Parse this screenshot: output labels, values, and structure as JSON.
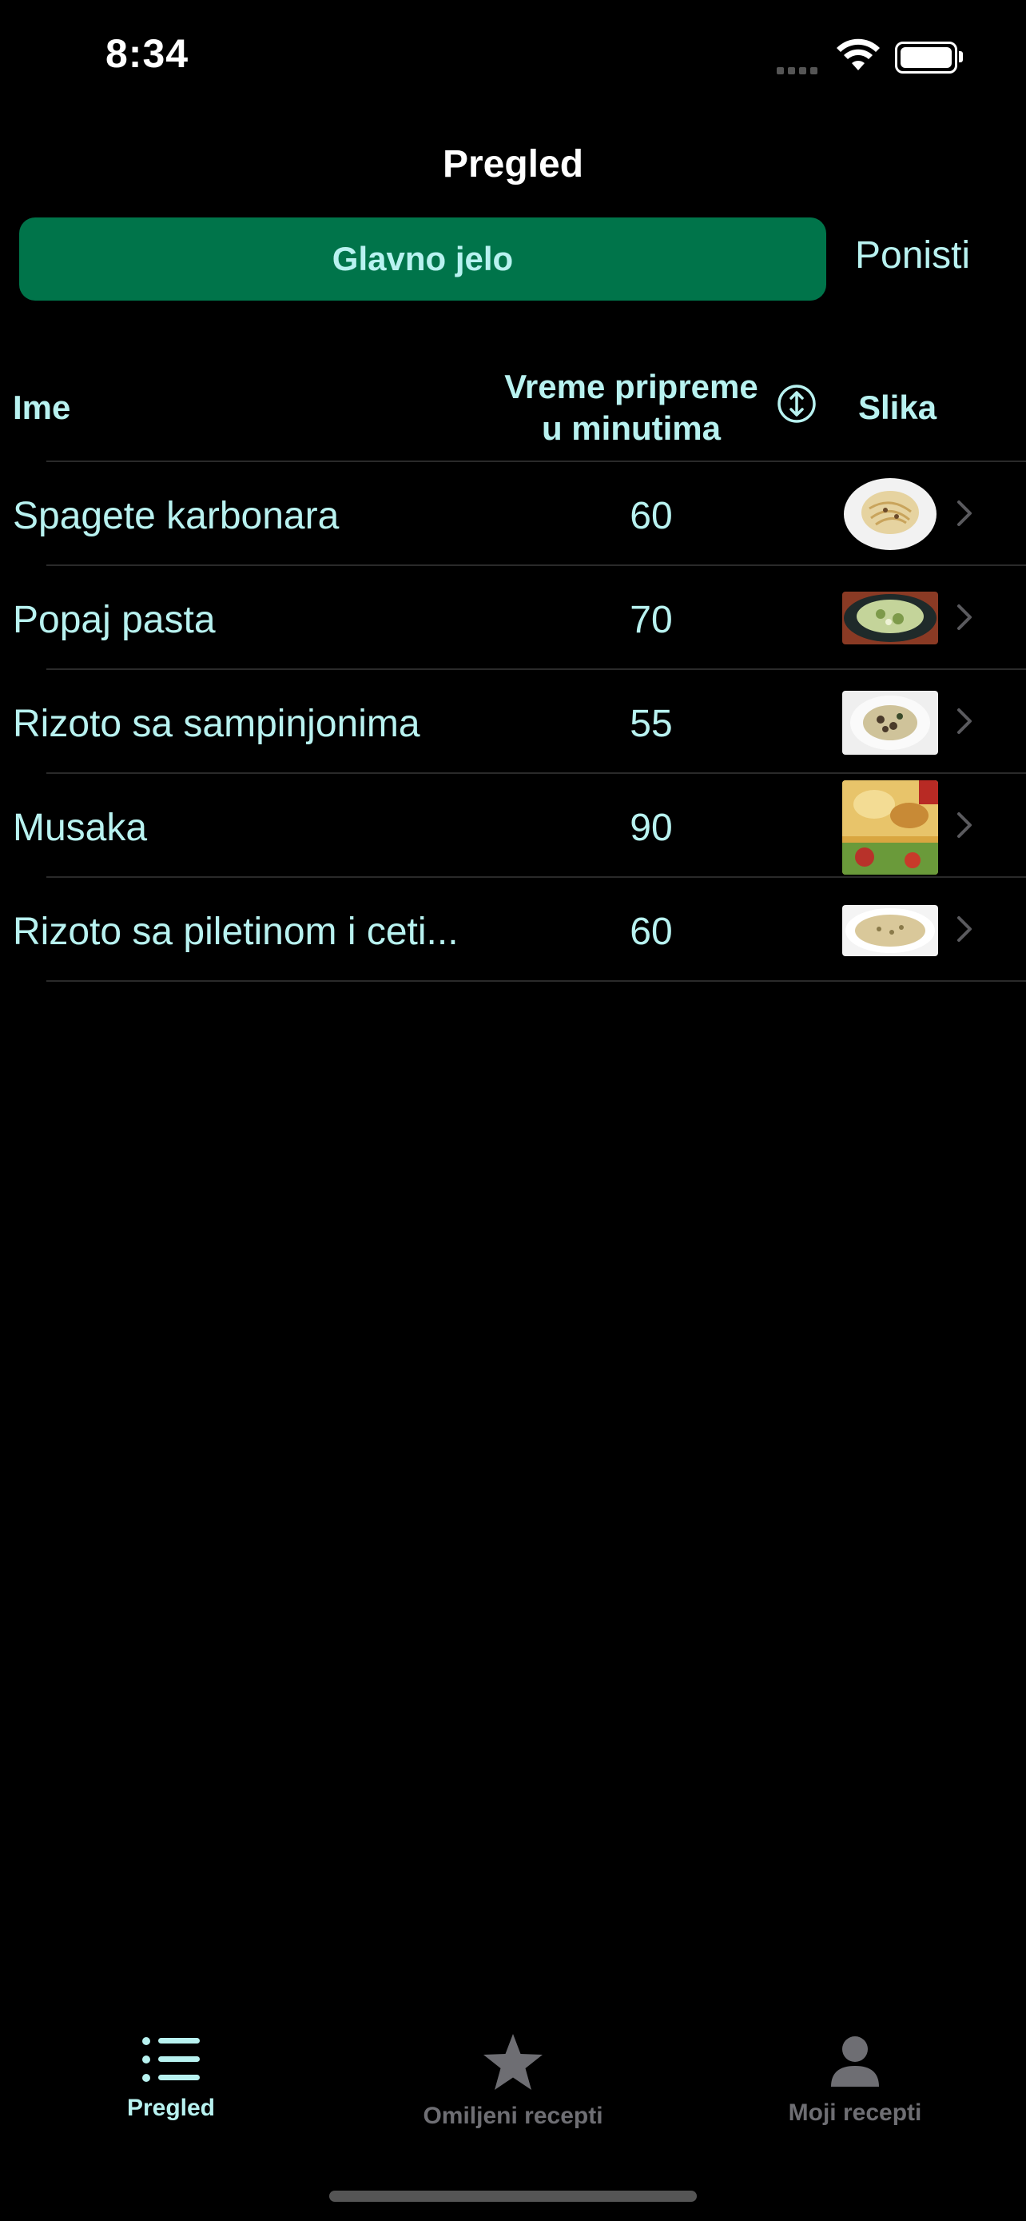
{
  "status": {
    "time": "8:34"
  },
  "nav": {
    "title": "Pregled"
  },
  "filter": {
    "chip_label": "Glavno jelo",
    "reset_label": "Ponisti"
  },
  "table": {
    "headers": {
      "name": "Ime",
      "time_line1": "Vreme pripreme",
      "time_line2": "u minutima",
      "image": "Slika"
    },
    "rows": [
      {
        "name": "Spagete karbonara",
        "minutes": "60"
      },
      {
        "name": "Popaj pasta",
        "minutes": "70"
      },
      {
        "name": "Rizoto sa sampinjonima",
        "minutes": "55"
      },
      {
        "name": "Musaka",
        "minutes": "90"
      },
      {
        "name": "Rizoto sa piletinom i ceti...",
        "minutes": "60"
      }
    ]
  },
  "tabbar": {
    "items": [
      {
        "label": "Pregled",
        "icon": "list-icon",
        "active": true
      },
      {
        "label": "Omiljeni recepti",
        "icon": "star-icon",
        "active": false
      },
      {
        "label": "Moji recepti",
        "icon": "person-icon",
        "active": false
      }
    ]
  },
  "colors": {
    "accent": "#b8f2f0",
    "chip_bg": "#00744a",
    "inactive": "#6e6e73",
    "background": "#000000"
  }
}
